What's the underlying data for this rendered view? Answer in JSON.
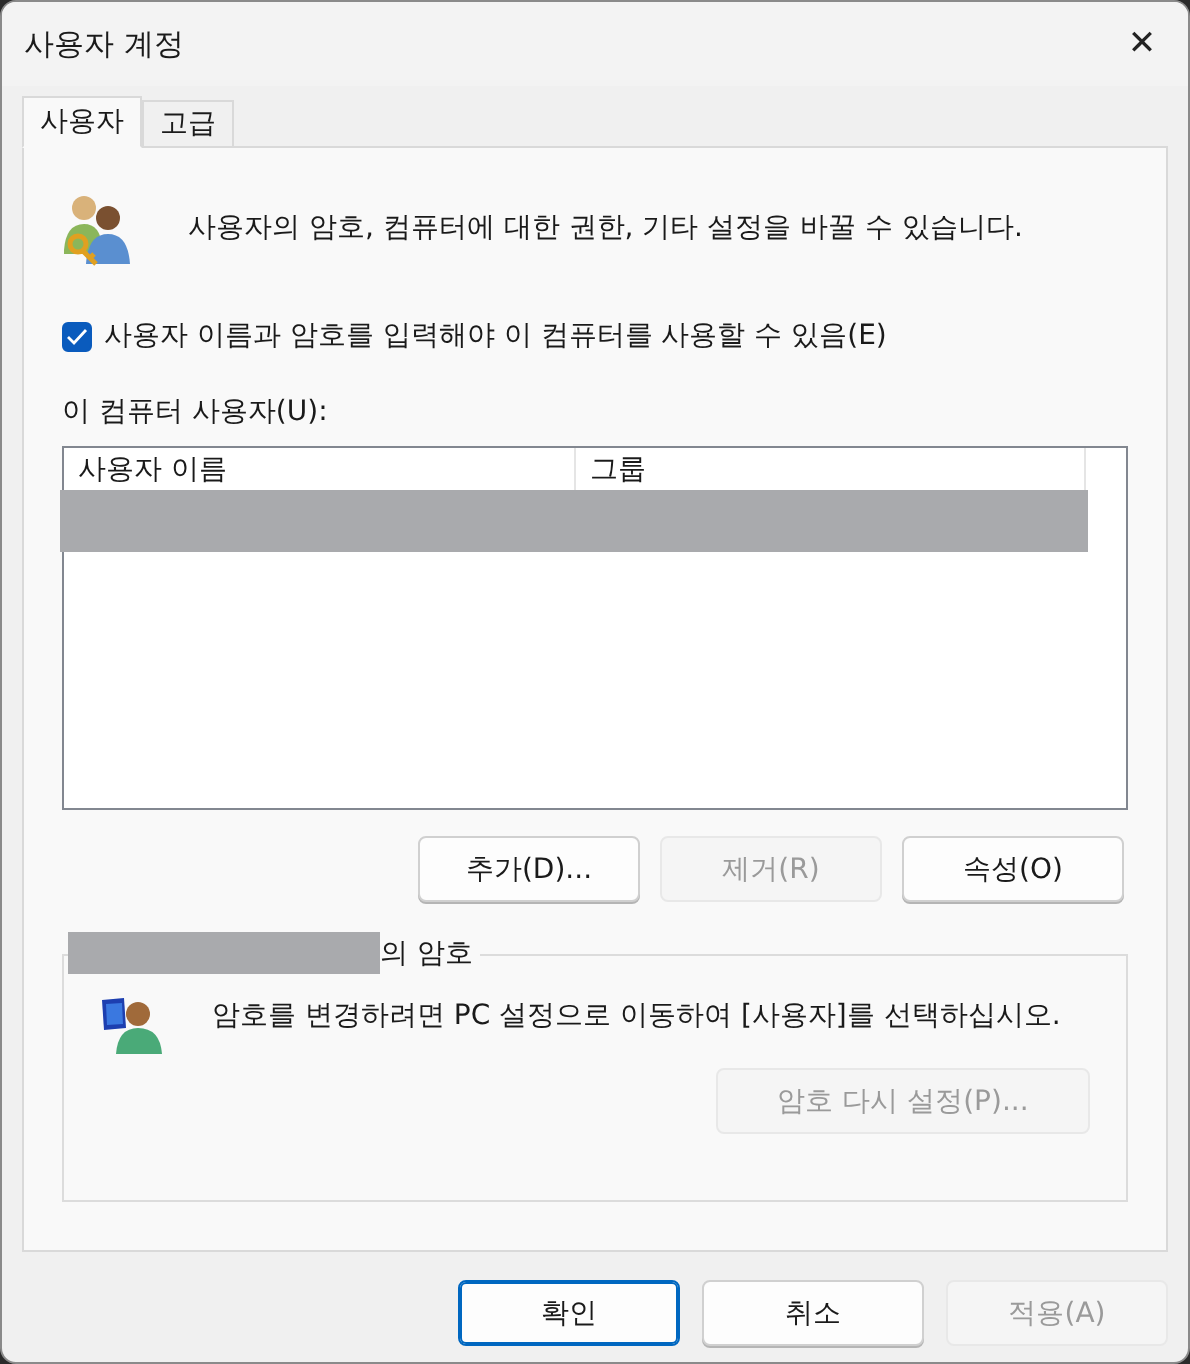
{
  "window": {
    "title": "사용자 계정",
    "close": "✕"
  },
  "tabs": [
    {
      "label": "사용자",
      "selected": true
    },
    {
      "label": "고급",
      "selected": false
    }
  ],
  "description": "사용자의 암호, 컴퓨터에 대한 권한, 기타 설정을 바꿀 수 있습니다.",
  "require_login": {
    "label": "사용자 이름과 암호를 입력해야 이 컴퓨터를 사용할 수 있음(E)",
    "checked": true
  },
  "users_label": "이 컴퓨터 사용자(U):",
  "table": {
    "columns": [
      "사용자 이름",
      "그룹"
    ]
  },
  "list_buttons": [
    {
      "label": "추가(D)...",
      "disabled": false
    },
    {
      "label": "제거(R)",
      "disabled": true
    },
    {
      "label": "속성(O)",
      "disabled": false
    }
  ],
  "password_group": {
    "title_suffix": "의 암호",
    "text": "암호를 변경하려면 PC 설정으로 이동하여 [사용자]를 선택하십시오.",
    "button": {
      "label": "암호 다시 설정(P)...",
      "disabled": true
    }
  },
  "footer_buttons": [
    {
      "label": "확인",
      "disabled": false,
      "default": true
    },
    {
      "label": "취소",
      "disabled": false,
      "default": false
    },
    {
      "label": "적용(A)",
      "disabled": true,
      "default": false
    }
  ]
}
